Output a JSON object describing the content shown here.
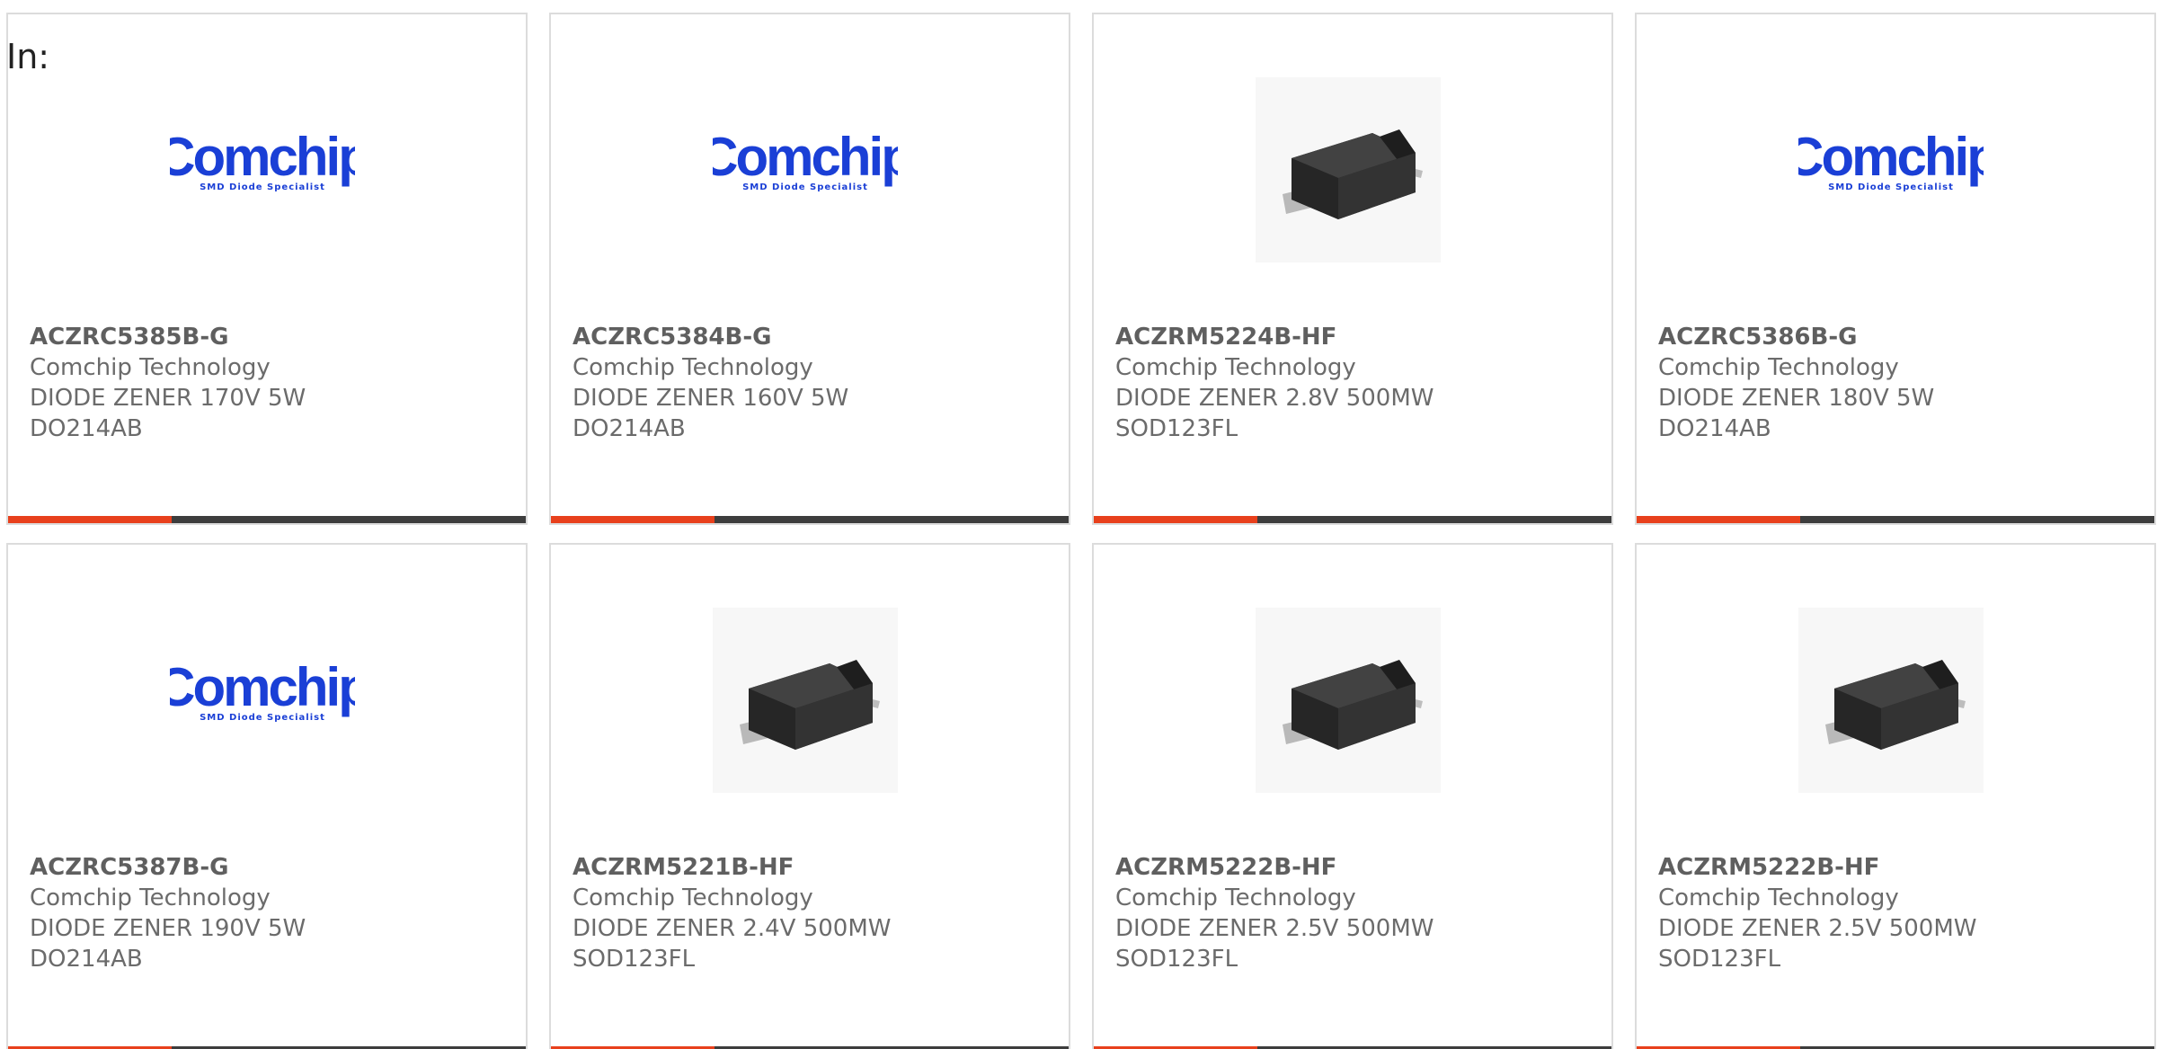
{
  "header": {
    "in_label": "In:"
  },
  "theme": {
    "accent_color": "#e8401c",
    "bar_color": "#3d3d3d",
    "logo_color": "#1a3fd6"
  },
  "products": [
    {
      "part_number": "ACZRC5385B-G",
      "manufacturer": "Comchip Technology",
      "description": "DIODE ZENER 170V 5W",
      "package": "DO214AB",
      "image": "comchip-logo",
      "logo_text": "Comchip",
      "logo_tagline": "SMD Diode Specialist"
    },
    {
      "part_number": "ACZRC5384B-G",
      "manufacturer": "Comchip Technology",
      "description": "DIODE ZENER 160V 5W",
      "package": "DO214AB",
      "image": "comchip-logo",
      "logo_text": "Comchip",
      "logo_tagline": "SMD Diode Specialist"
    },
    {
      "part_number": "ACZRM5224B-HF",
      "manufacturer": "Comchip Technology",
      "description": "DIODE ZENER 2.8V 500MW",
      "package": "SOD123FL",
      "image": "diode-package-photo"
    },
    {
      "part_number": "ACZRC5386B-G",
      "manufacturer": "Comchip Technology",
      "description": "DIODE ZENER 180V 5W",
      "package": "DO214AB",
      "image": "comchip-logo",
      "logo_text": "Comchip",
      "logo_tagline": "SMD Diode Specialist"
    },
    {
      "part_number": "ACZRC5387B-G",
      "manufacturer": "Comchip Technology",
      "description": "DIODE ZENER 190V 5W",
      "package": "DO214AB",
      "image": "comchip-logo",
      "logo_text": "Comchip",
      "logo_tagline": "SMD Diode Specialist"
    },
    {
      "part_number": "ACZRM5221B-HF",
      "manufacturer": "Comchip Technology",
      "description": "DIODE ZENER 2.4V 500MW",
      "package": "SOD123FL",
      "image": "diode-package-photo"
    },
    {
      "part_number": "ACZRM5222B-HF",
      "manufacturer": "Comchip Technology",
      "description": "DIODE ZENER 2.5V 500MW",
      "package": "SOD123FL",
      "image": "diode-package-photo"
    },
    {
      "part_number": "ACZRM5222B-HF",
      "manufacturer": "Comchip Technology",
      "description": "DIODE ZENER 2.5V 500MW",
      "package": "SOD123FL",
      "image": "diode-package-photo"
    }
  ]
}
